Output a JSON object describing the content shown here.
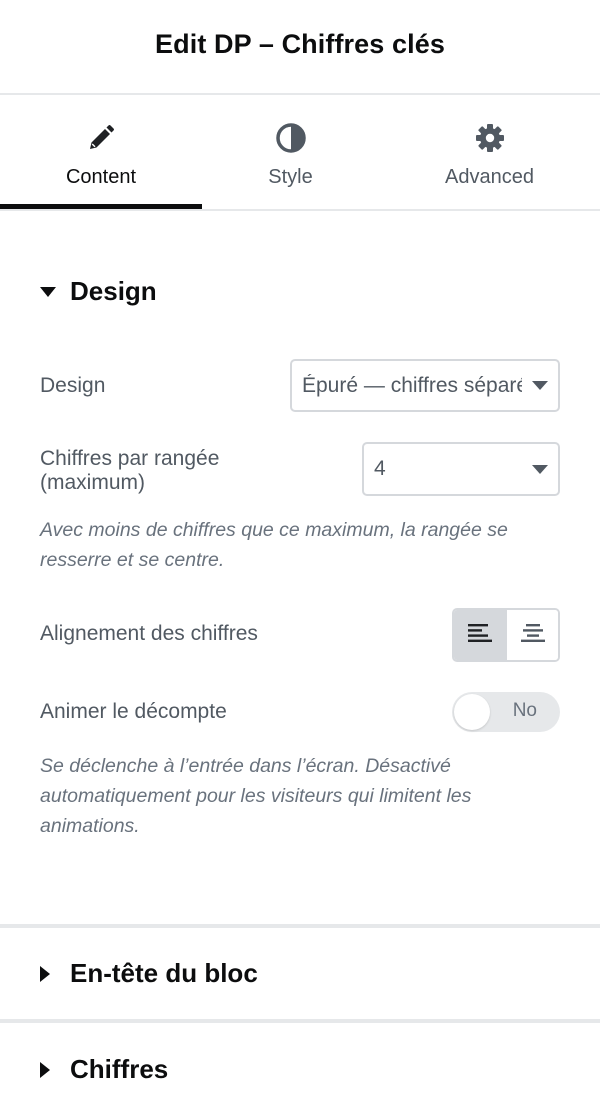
{
  "header": {
    "title": "Edit DP – Chiffres clés"
  },
  "tabs": [
    {
      "label": "Content",
      "icon": "pencil-icon",
      "active": true
    },
    {
      "label": "Style",
      "icon": "half-circle-icon",
      "active": false
    },
    {
      "label": "Advanced",
      "icon": "gear-icon",
      "active": false
    }
  ],
  "design_section": {
    "title": "Design",
    "expanded": true,
    "design_field": {
      "label": "Design",
      "value": "Épuré — chiffres séparés"
    },
    "per_row_field": {
      "label_line1": "Chiffres par rangée",
      "label_line2": "(maximum)",
      "value": "4"
    },
    "per_row_help": "Avec moins de chiffres que ce maximum, la rangée se resserre et se centre.",
    "alignment_field": {
      "label": "Alignement des chiffres",
      "options": [
        "align-left",
        "align-center"
      ],
      "selected": "align-left"
    },
    "animate_field": {
      "label": "Animer le décompte",
      "value": "No",
      "enabled": false
    },
    "animate_help": "Se déclenche à l’entrée dans l’écran. Désactivé automatiquement pour les visiteurs qui limitent les animations."
  },
  "collapsed_sections": [
    {
      "title": "En-tête du bloc"
    },
    {
      "title": "Chiffres"
    }
  ],
  "colors": {
    "text_dark": "#0c0d0e",
    "text_muted": "#515962",
    "help": "#69727d",
    "border": "#d5d8dc",
    "divider": "#e6e8ea"
  }
}
